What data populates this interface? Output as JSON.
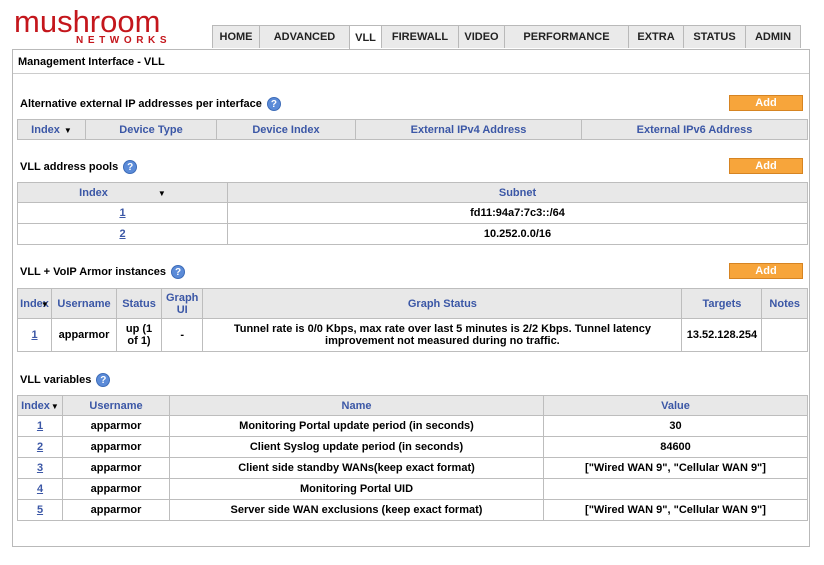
{
  "logo": {
    "main": "mushroom",
    "sub": "NETWORKS"
  },
  "nav": [
    "HOME",
    "ADVANCED",
    "VLL",
    "FIREWALL",
    "VIDEO",
    "PERFORMANCE",
    "EXTRA",
    "STATUS",
    "ADMIN"
  ],
  "active_tab": "VLL",
  "panel_title": "Management Interface - VLL",
  "help_glyph": "?",
  "arrow_glyph": "▼",
  "add_label": "Add",
  "alt_ip": {
    "title": "Alternative external IP addresses per interface",
    "headers": [
      "Index",
      "Device Type",
      "Device Index",
      "External IPv4 Address",
      "External IPv6 Address"
    ]
  },
  "pools": {
    "title": "VLL address pools",
    "headers": [
      "Index",
      "Subnet"
    ],
    "rows": [
      {
        "index": "1",
        "subnet": "fd11:94a7:7c3::/64"
      },
      {
        "index": "2",
        "subnet": "10.252.0.0/16"
      }
    ]
  },
  "instances": {
    "title": "VLL + VoIP Armor instances",
    "headers": [
      "Index",
      "Username",
      "Status",
      "Graph UI",
      "Graph Status",
      "Targets",
      "Notes"
    ],
    "rows": [
      {
        "index": "1",
        "username": "apparmor",
        "status": "up (1 of 1)",
        "graph_ui": "-",
        "graph_status": "Tunnel rate is 0/0 Kbps, max rate over last 5 minutes is 2/2 Kbps. Tunnel latency improvement not measured during no traffic.",
        "targets": "13.52.128.254",
        "notes": ""
      }
    ]
  },
  "variables": {
    "title": "VLL variables",
    "headers": [
      "Index",
      "Username",
      "Name",
      "Value"
    ],
    "rows": [
      {
        "index": "1",
        "username": "apparmor",
        "name": "Monitoring Portal update period (in seconds)",
        "value": "30"
      },
      {
        "index": "2",
        "username": "apparmor",
        "name": "Client Syslog update period (in seconds)",
        "value": "84600"
      },
      {
        "index": "3",
        "username": "apparmor",
        "name": "Client side standby WANs(keep exact format)",
        "value": "[\"Wired WAN 9\", \"Cellular WAN 9\"]"
      },
      {
        "index": "4",
        "username": "apparmor",
        "name": "Monitoring Portal UID",
        "value": ""
      },
      {
        "index": "5",
        "username": "apparmor",
        "name": "Server side WAN exclusions (keep exact format)",
        "value": "[\"Wired WAN 9\", \"Cellular WAN 9\"]"
      }
    ]
  },
  "colors": {
    "brand": "#c4161c",
    "add_button": "#f7a53b",
    "header_text": "#3b57a6",
    "help_icon": "#5b8bd8"
  }
}
